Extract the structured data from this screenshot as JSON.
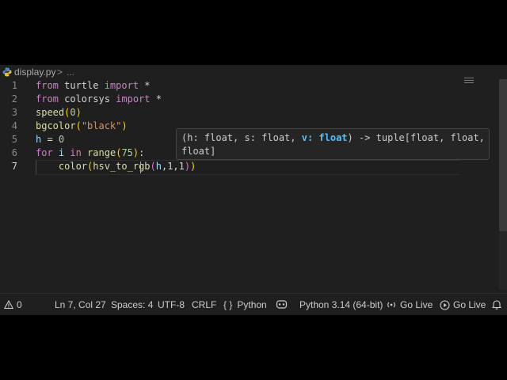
{
  "breadcrumb": {
    "file": "display.py",
    "separator": ">",
    "ellipsis": "..."
  },
  "editor": {
    "line_numbers": [
      "1",
      "2",
      "3",
      "4",
      "5",
      "6",
      "7"
    ],
    "lines": [
      [
        {
          "t": "from",
          "c": "kw"
        },
        {
          "t": " turtle ",
          "c": "op"
        },
        {
          "t": "import",
          "c": "kw"
        },
        {
          "t": " *",
          "c": "op"
        }
      ],
      [
        {
          "t": "from",
          "c": "kw"
        },
        {
          "t": " colorsys ",
          "c": "op"
        },
        {
          "t": "import",
          "c": "kw"
        },
        {
          "t": " *",
          "c": "op"
        }
      ],
      [
        {
          "t": "speed",
          "c": "fn"
        },
        {
          "t": "(",
          "c": "br1"
        },
        {
          "t": "0",
          "c": "num"
        },
        {
          "t": ")",
          "c": "br1"
        }
      ],
      [
        {
          "t": "bgcolor",
          "c": "fn"
        },
        {
          "t": "(",
          "c": "br1"
        },
        {
          "t": "\"black\"",
          "c": "str"
        },
        {
          "t": ")",
          "c": "br1"
        }
      ],
      [
        {
          "t": "h",
          "c": "var"
        },
        {
          "t": " = ",
          "c": "op"
        },
        {
          "t": "0",
          "c": "num"
        }
      ],
      [
        {
          "t": "for",
          "c": "kw"
        },
        {
          "t": " ",
          "c": "op"
        },
        {
          "t": "i",
          "c": "var"
        },
        {
          "t": " ",
          "c": "op"
        },
        {
          "t": "in",
          "c": "kw"
        },
        {
          "t": " ",
          "c": "op"
        },
        {
          "t": "range",
          "c": "fn"
        },
        {
          "t": "(",
          "c": "br1"
        },
        {
          "t": "75",
          "c": "num"
        },
        {
          "t": ")",
          "c": "br1"
        },
        {
          "t": ":",
          "c": "op"
        }
      ],
      [
        {
          "t": "    ",
          "c": "op"
        },
        {
          "t": "color",
          "c": "fn"
        },
        {
          "t": "(",
          "c": "br1"
        },
        {
          "t": "hsv_to_rgb",
          "c": "fn"
        },
        {
          "t": "(",
          "c": "br2"
        },
        {
          "t": "h",
          "c": "var"
        },
        {
          "t": ",1,1",
          "c": "op"
        },
        {
          "t": ")",
          "c": "br2"
        },
        {
          "t": ")",
          "c": "br1"
        }
      ]
    ]
  },
  "tooltip": {
    "part1": "(h: float, s: float, ",
    "highlight": "v: float",
    "part2": ") -> tuple[float, float,",
    "line2": "float]"
  },
  "statusbar": {
    "errors": "0",
    "position": "Ln 7, Col 27",
    "spaces": "Spaces: 4",
    "encoding": "UTF-8",
    "eol": "CRLF",
    "language_glyph": "{ }",
    "language": "Python",
    "interpreter": "Python 3.14 (64-bit)",
    "golive1": "Go Live",
    "golive2": "Go Live"
  }
}
